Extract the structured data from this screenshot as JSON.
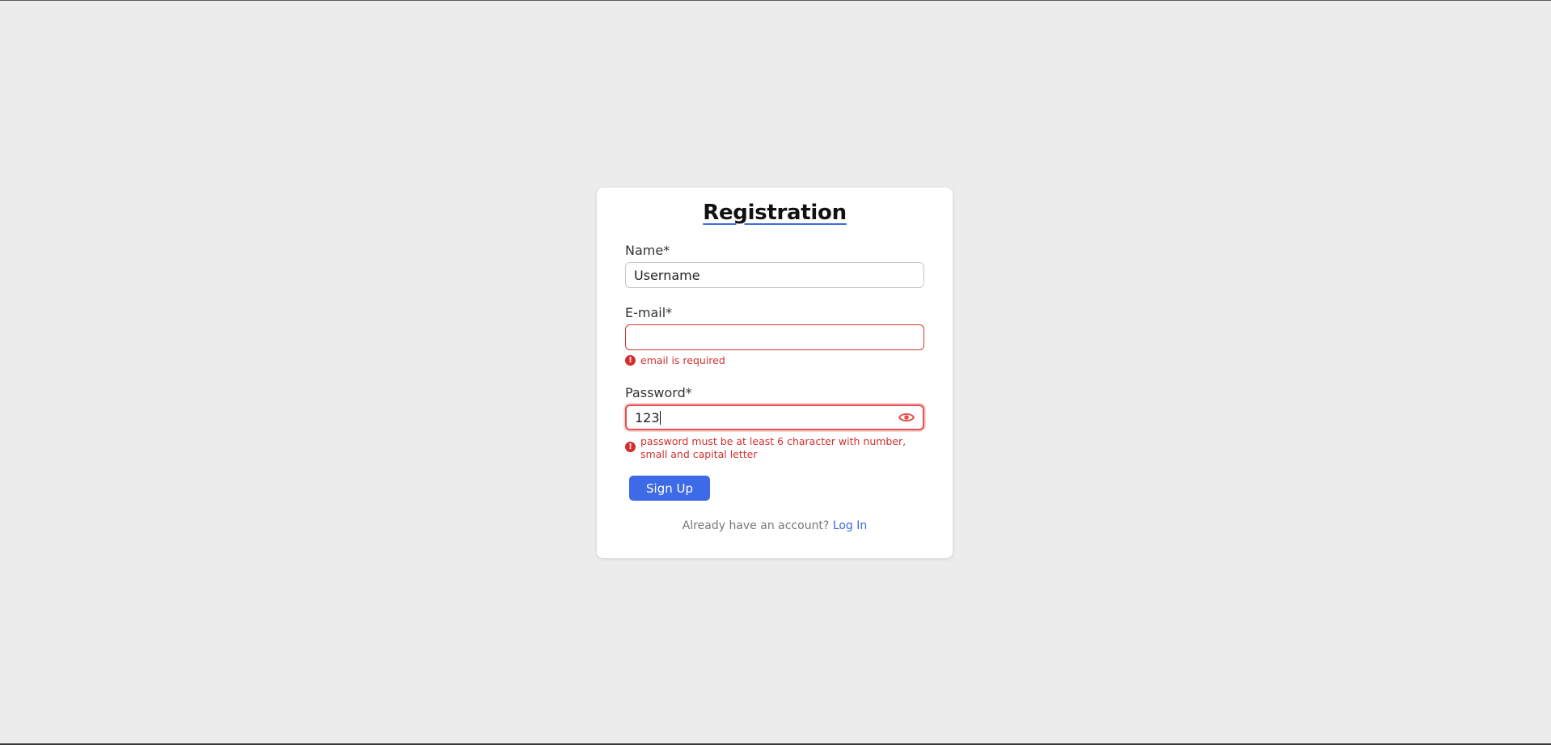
{
  "form": {
    "title": "Registration",
    "name": {
      "label": "Name*",
      "value": "Username"
    },
    "email": {
      "label": "E-mail*",
      "value": "",
      "error": "email is required"
    },
    "password": {
      "label": "Password*",
      "value": "123",
      "error": "password must be at least 6 character with number, small and capital letter"
    },
    "submit_label": "Sign Up",
    "footer_text": "Already have an account?",
    "login_label": "Log In"
  },
  "icons": {
    "error": "exclamation-circle-icon",
    "toggle_password": "eye-icon"
  },
  "colors": {
    "background": "#ececec",
    "primary": "#3d6ae6",
    "error": "#d12f2f"
  }
}
